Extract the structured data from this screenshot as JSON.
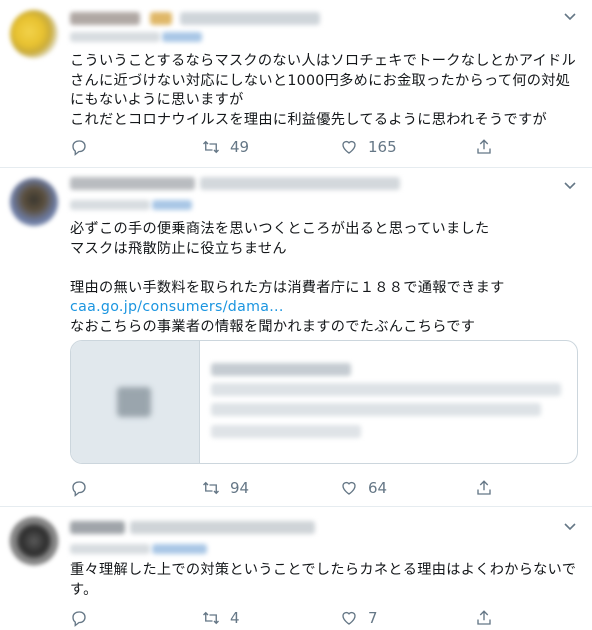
{
  "tweets": [
    {
      "text": "こういうことするならマスクのない人はソロチェキでトークなしとかアイドルさんに近づけない対応にしないと1000円多めにお金取ったからって何の対処にもないように思いますが\nこれだとコロナウイルスを理由に利益優先してるように思われそうですが",
      "actions": {
        "reply": "",
        "retweet": "49",
        "like": "165"
      }
    },
    {
      "text_before_link": "必ずこの手の便乗商法を思いつくところが出ると思っていました\nマスクは飛散防止に役立ちません\n\n理由の無い手数料を取られた方は消費者庁に１８８で通報できます",
      "link": "caa.go.jp/consumers/dama...",
      "text_after_link": "\nなおこちらの事業者の情報を聞かれますのでたぶんこちらです",
      "actions": {
        "reply": "",
        "retweet": "94",
        "like": "64"
      }
    },
    {
      "text": "重々理解した上での対策ということでしたらカネとる理由はよくわからないです。",
      "actions": {
        "reply": "",
        "retweet": "4",
        "like": "7"
      }
    }
  ],
  "icons": {
    "reply": "reply-icon",
    "retweet": "retweet-icon",
    "like": "heart-icon",
    "share": "share-icon",
    "menu": "chevron-down-icon"
  },
  "colors": {
    "link": "#1b95e0",
    "icon": "#657786",
    "border": "#e6ecf0"
  }
}
